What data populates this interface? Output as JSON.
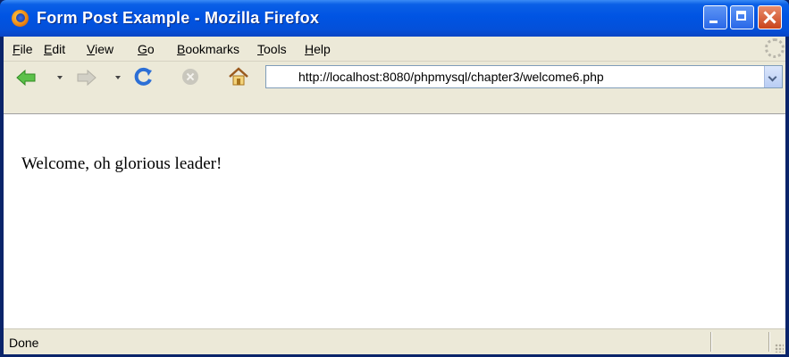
{
  "window": {
    "title": "Form Post Example - Mozilla Firefox",
    "app_icon": "firefox-icon",
    "controls": [
      "minimize-icon",
      "maximize-icon",
      "close-icon"
    ]
  },
  "menubar": {
    "items": [
      {
        "label": "File",
        "accel": "F",
        "rest": "ile"
      },
      {
        "label": "Edit",
        "accel": "E",
        "rest": "dit"
      },
      {
        "label": "View",
        "accel": "V",
        "rest": "iew"
      },
      {
        "label": "Go",
        "accel": "G",
        "rest": "o"
      },
      {
        "label": "Bookmarks",
        "accel": "B",
        "rest": "ookmarks"
      },
      {
        "label": "Tools",
        "accel": "T",
        "rest": "ools"
      },
      {
        "label": "Help",
        "accel": "H",
        "rest": "elp"
      }
    ]
  },
  "toolbar": {
    "icons": [
      "back-icon",
      "forward-icon",
      "reload-icon",
      "stop-icon",
      "home-icon"
    ],
    "url": "http://localhost:8080/phpmysql/chapter3/welcome6.php"
  },
  "page": {
    "message": "Welcome, oh glorious leader!"
  },
  "statusbar": {
    "text": "Done"
  },
  "colors": {
    "titlebar": "#0054e3",
    "chrome": "#ece9d8",
    "close_button": "#c9441b"
  }
}
